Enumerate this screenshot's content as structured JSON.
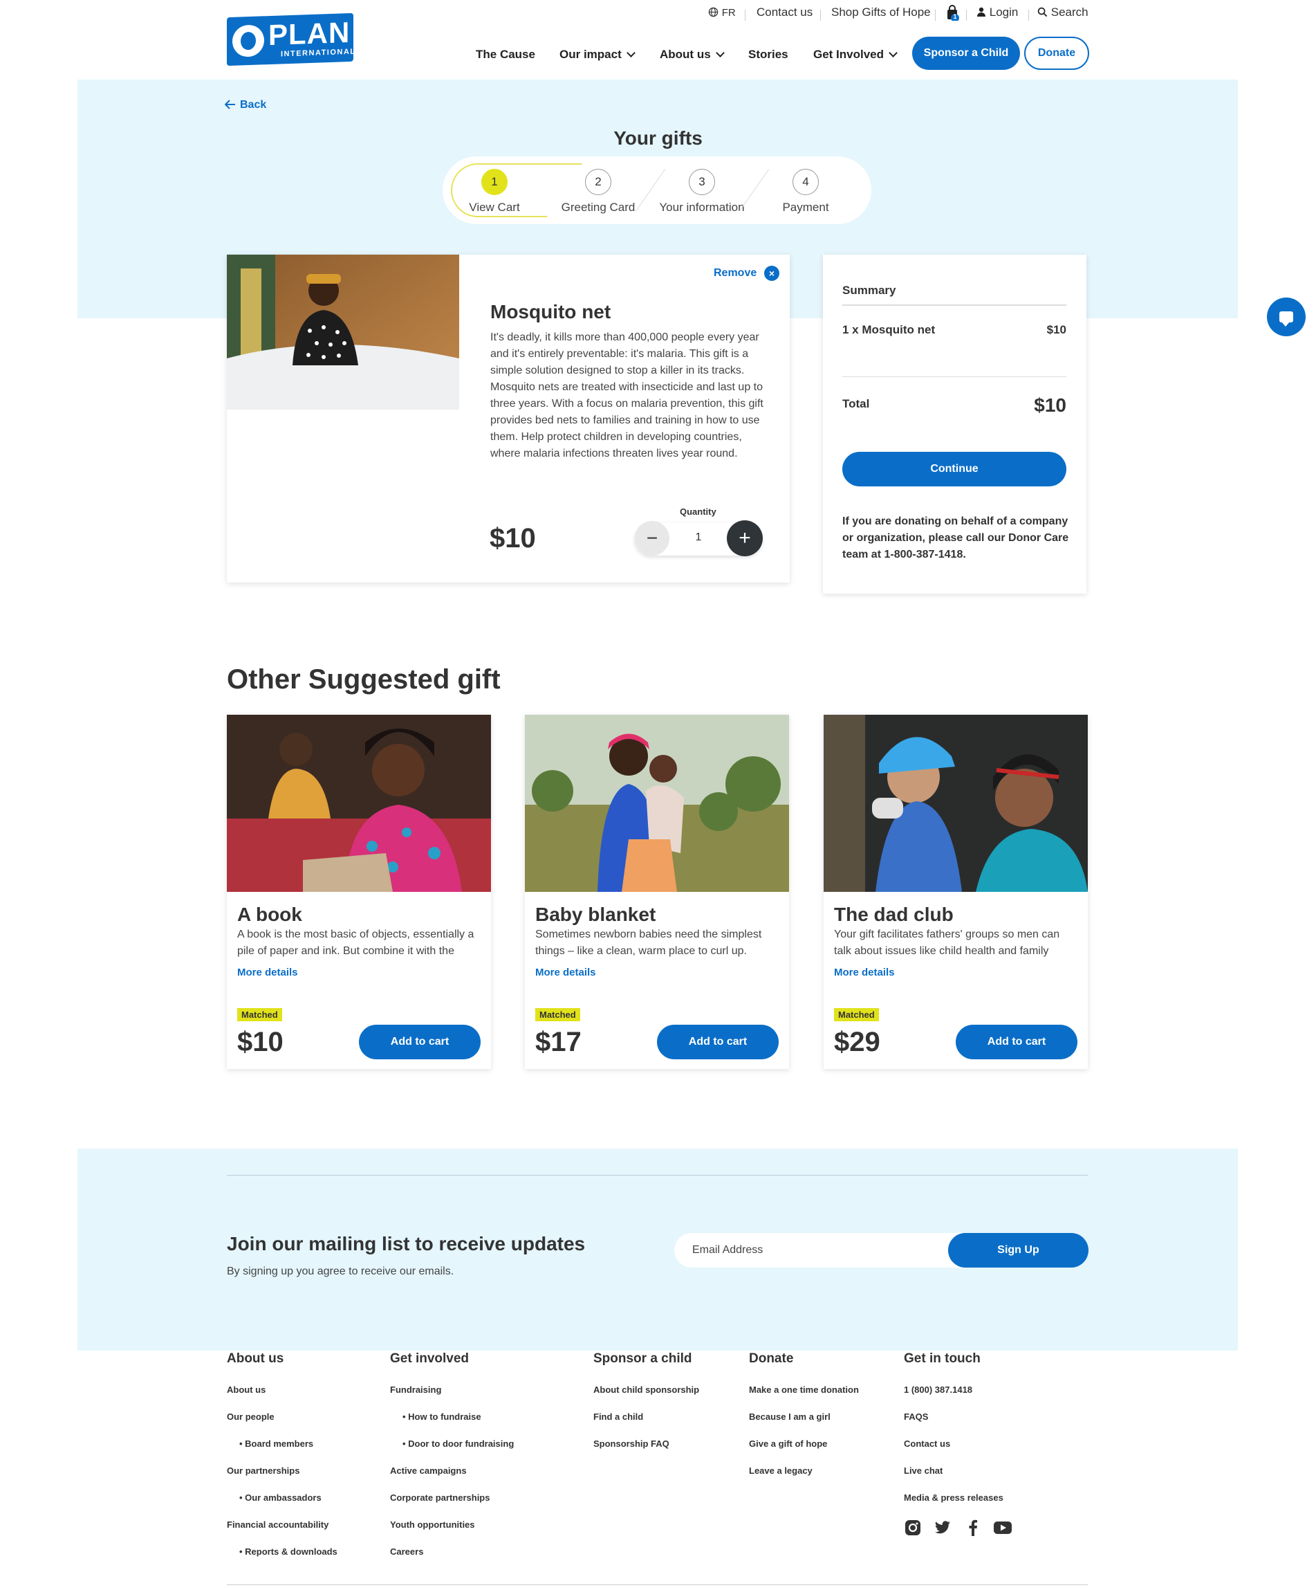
{
  "header": {
    "logo_text": "PLAN",
    "logo_sub": "INTERNATIONAL",
    "util": {
      "lang": "FR",
      "contact": "Contact us",
      "shop": "Shop Gifts of Hope",
      "cart_count": "1",
      "login": "Login",
      "search": "Search"
    },
    "nav": [
      "The Cause",
      "Our impact",
      "About us",
      "Stories",
      "Get Involved"
    ],
    "sponsor_label": "Sponsor a Child",
    "donate_label": "Donate"
  },
  "back_label": "Back",
  "page_title": "Your gifts",
  "steps": [
    {
      "num": "1",
      "label": "View Cart"
    },
    {
      "num": "2",
      "label": "Greeting Card"
    },
    {
      "num": "3",
      "label": "Your information"
    },
    {
      "num": "4",
      "label": "Payment"
    }
  ],
  "cart_item": {
    "remove_label": "Remove",
    "name": "Mosquito net",
    "description": "It's deadly, it kills more than 400,000 people every year and it's entirely preventable: it's malaria. This gift is a simple solution designed to stop a killer in its tracks. Mosquito nets are treated with insecticide and last up to three years. With a focus on malaria prevention, this gift provides bed nets to families and training in how to use them. Help protect children in developing countries, where malaria infections threaten lives year round.",
    "price": "$10",
    "quantity_label": "Quantity",
    "quantity": "1"
  },
  "summary": {
    "title": "Summary",
    "item_label": "1 x Mosquito net",
    "item_price": "$10",
    "total_label": "Total",
    "total_price": "$10",
    "continue_label": "Continue",
    "note": "If you are donating on behalf of a company or organization, please call our Donor Care team at 1-800-387-1418."
  },
  "suggested": {
    "title": "Other Suggested gift",
    "more_label": "More details",
    "badge": "Matched",
    "add_label": "Add to cart",
    "gifts": [
      {
        "name": "A book",
        "description": "A book is the most basic of objects, essentially a pile of paper and ink. But combine it with the",
        "price": "$10"
      },
      {
        "name": "Baby blanket",
        "description": "Sometimes newborn babies need the simplest things – like a clean, warm place to curl up.",
        "price": "$17"
      },
      {
        "name": "The dad club",
        "description": "Your gift facilitates fathers' groups so men can talk about issues like child health and family",
        "price": "$29"
      }
    ]
  },
  "mailing": {
    "title": "Join our mailing list to receive updates",
    "subtitle": "By signing up you agree to receive our emails.",
    "placeholder": "Email Address",
    "button": "Sign Up"
  },
  "footer": {
    "about": {
      "title": "About us",
      "items": [
        "About us",
        "Our people",
        "• Board members",
        "Our partnerships",
        "• Our ambassadors",
        "Financial accountability",
        "• Reports & downloads"
      ]
    },
    "involved": {
      "title": "Get involved",
      "items": [
        "Fundraising",
        "• How to fundraise",
        "• Door to door fundraising",
        "Active campaigns",
        "Corporate partnerships",
        "Youth opportunities",
        "Careers"
      ]
    },
    "sponsor": {
      "title": "Sponsor a child",
      "items": [
        "About child sponsorship",
        "Find a child",
        "Sponsorship FAQ"
      ]
    },
    "donate": {
      "title": "Donate",
      "items": [
        "Make a one time donation",
        "Because I am a girl",
        "Give a gift of hope",
        "Leave a legacy"
      ]
    },
    "touch": {
      "title": "Get in touch",
      "items": [
        "1 (800) 387.1418",
        "FAQS",
        "Contact us",
        "Live chat",
        "Media & press releases"
      ]
    },
    "social_icons": [
      "instagram-icon",
      "twitter-icon",
      "facebook-icon",
      "youtube-icon"
    ]
  },
  "colors": {
    "brand_blue": "#0a6ec8",
    "band": "#e5f6fc",
    "accent_yellow": "#e2e21b"
  }
}
